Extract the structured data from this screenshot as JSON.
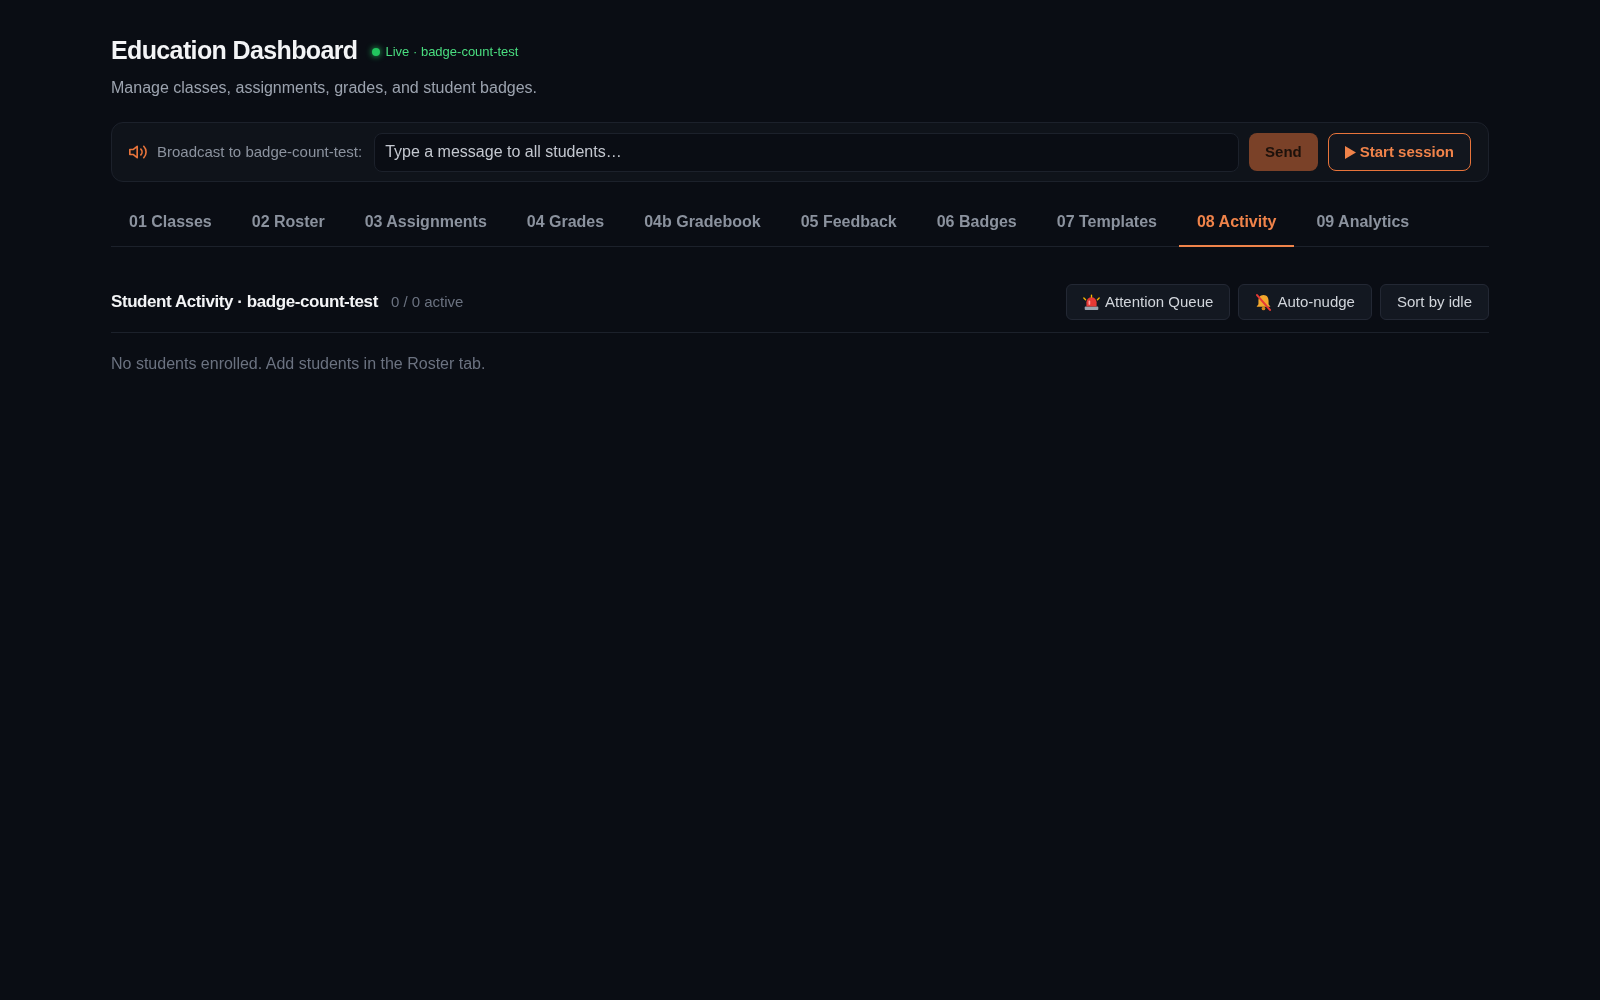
{
  "header": {
    "title": "Education Dashboard",
    "status": "Live · badge-count-test",
    "subtitle": "Manage classes, assignments, grades, and student badges."
  },
  "broadcast": {
    "label": "Broadcast to badge-count-test:",
    "placeholder": "Type a message to all students…",
    "buttons": [
      {
        "label": "Send",
        "kind": "send"
      },
      {
        "label": "Start session",
        "kind": "start"
      }
    ]
  },
  "tabs": [
    {
      "label": "01 Classes",
      "selected": false
    },
    {
      "label": "02 Roster",
      "selected": false
    },
    {
      "label": "03 Assignments",
      "selected": false
    },
    {
      "label": "04 Grades",
      "selected": false
    },
    {
      "label": "04b Gradebook",
      "selected": false
    },
    {
      "label": "05 Feedback",
      "selected": false
    },
    {
      "label": "06 Badges",
      "selected": false
    },
    {
      "label": "07 Templates",
      "selected": false
    },
    {
      "label": "08 Activity",
      "selected": true
    },
    {
      "label": "09 Analytics",
      "selected": false
    }
  ],
  "activity": {
    "title": "Student Activity · badge-count-test",
    "count": "0 / 0 active",
    "actions": [
      {
        "label": "Attention Queue",
        "kind": "alert"
      },
      {
        "label": "Auto-nudge",
        "kind": "mute"
      },
      {
        "label": "Sort by idle",
        "kind": "sort"
      }
    ],
    "empty_message": "No students enrolled. Add students in the Roster tab."
  }
}
